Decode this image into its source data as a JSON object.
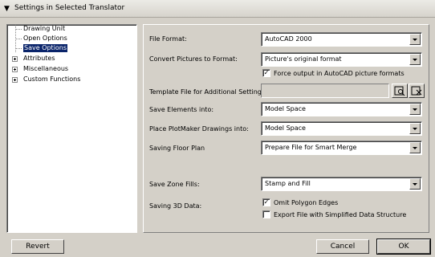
{
  "header": {
    "title": "Settings in Selected Translator"
  },
  "tree": {
    "items": [
      {
        "label": "Drawing Unit"
      },
      {
        "label": "Open Options"
      },
      {
        "label": "Save Options",
        "selected": true
      },
      {
        "label": "Attributes"
      },
      {
        "label": "Miscellaneous"
      },
      {
        "label": "Custom Functions"
      }
    ]
  },
  "settings": {
    "file_format": {
      "label": "File Format:",
      "value": "AutoCAD 2000"
    },
    "convert_pictures": {
      "label": "Convert Pictures to Format:",
      "value": "Picture's original format"
    },
    "force_output": {
      "label": "Force output in AutoCAD picture formats",
      "checked": true
    },
    "template_file": {
      "label": "Template File for Additional Settings:",
      "value": ""
    },
    "save_elements": {
      "label": "Save Elements into:",
      "value": "Model Space"
    },
    "place_plotmaker": {
      "label": "Place PlotMaker Drawings into:",
      "value": "Model Space"
    },
    "saving_floor_plan": {
      "label": "Saving Floor Plan",
      "value": "Prepare File for Smart Merge"
    },
    "save_zone_fills": {
      "label": "Save Zone Fills:",
      "value": "Stamp and Fill"
    },
    "saving_3d": {
      "label": "Saving 3D Data:"
    },
    "omit_polygon_edges": {
      "label": "Omit Polygon Edges",
      "checked": true
    },
    "export_simplified": {
      "label": "Export File with Simplified Data Structure",
      "checked": false
    }
  },
  "footer": {
    "revert": "Revert",
    "cancel": "Cancel",
    "ok": "OK"
  }
}
